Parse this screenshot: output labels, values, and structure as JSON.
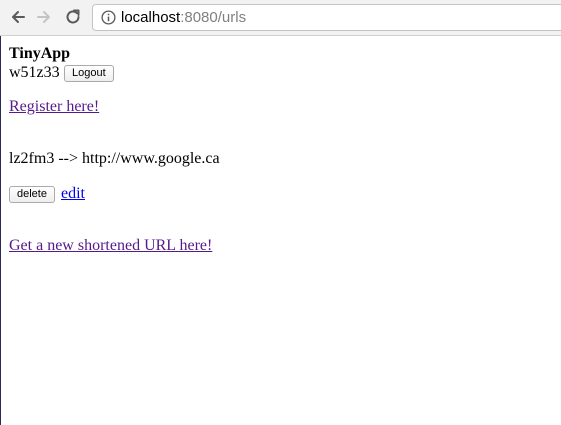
{
  "browser": {
    "url_host": "localhost",
    "url_rest": ":8080/urls",
    "icons": [
      "back-arrow-icon",
      "forward-arrow-icon",
      "reload-icon",
      "info-icon"
    ]
  },
  "header": {
    "app_title": "TinyApp",
    "username": "w51z33",
    "logout_label": "Logout"
  },
  "register_link": "Register here! ",
  "urls": [
    {
      "entry": "lz2fm3 --> http://www.google.ca",
      "delete_label": "delete",
      "edit_label": "edit"
    }
  ],
  "new_url_link": "Get a new shortened URL here!",
  "colors": {
    "visited_link": "#551a8b",
    "link": "#0000ee",
    "toolbar": "#f2f2f2"
  }
}
